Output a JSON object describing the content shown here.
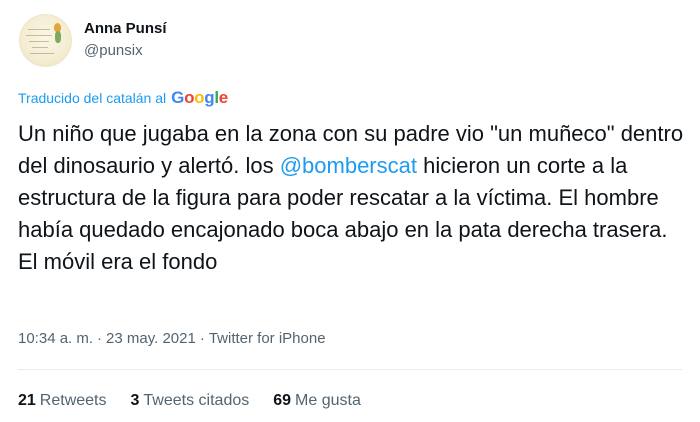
{
  "author": {
    "display_name": "Anna Punsí",
    "handle": "@punsix",
    "avatar_icon": "profile-avatar"
  },
  "translation": {
    "label": "Traducido del catalán al",
    "provider": "Google"
  },
  "tweet": {
    "text_part1": "Un niño que jugaba en la zona con su padre vio \"un muñeco\" dentro del dinosaurio y alertó. los ",
    "mention": "@bomberscat",
    "text_part2": " hicieron un corte a la estructura de la figura para poder rescatar a la víctima. El hombre había quedado encajonado boca abajo en la pata derecha trasera. El móvil era el fondo"
  },
  "meta": {
    "time": "10:34 a. m.",
    "date": "23 may. 2021",
    "source": "Twitter for iPhone",
    "separator": "·"
  },
  "stats": {
    "retweets_count": "21",
    "retweets_label": "Retweets",
    "quotes_count": "3",
    "quotes_label": "Tweets citados",
    "likes_count": "69",
    "likes_label": "Me gusta"
  },
  "colors": {
    "link": "#1d9bf0",
    "text": "#0f1419",
    "secondary": "#536471"
  }
}
